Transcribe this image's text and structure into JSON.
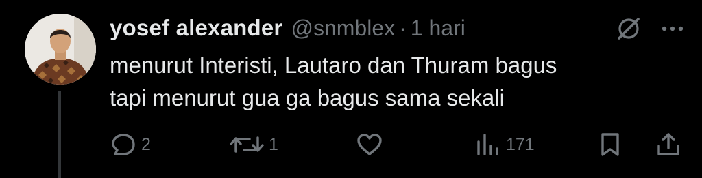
{
  "tweet": {
    "author": {
      "display_name": "yosef alexander",
      "handle": "@snmblex"
    },
    "separator": "·",
    "time": "1 hari",
    "text_lines": [
      "menurut Interisti, Lautaro dan Thuram bagus",
      "tapi menurut gua ga bagus sama sekali"
    ],
    "actions": {
      "reply_count": "2",
      "retweet_count": "1",
      "views_count": "171"
    }
  },
  "icons": {
    "header": [
      "grok-icon",
      "more-icon"
    ],
    "actions": [
      "reply-icon",
      "retweet-icon",
      "like-icon",
      "views-icon",
      "bookmark-icon",
      "share-icon"
    ]
  },
  "colors": {
    "background": "#000000",
    "text_primary": "#e7e9ea",
    "text_secondary": "#71767b",
    "thread_line": "#333639"
  }
}
